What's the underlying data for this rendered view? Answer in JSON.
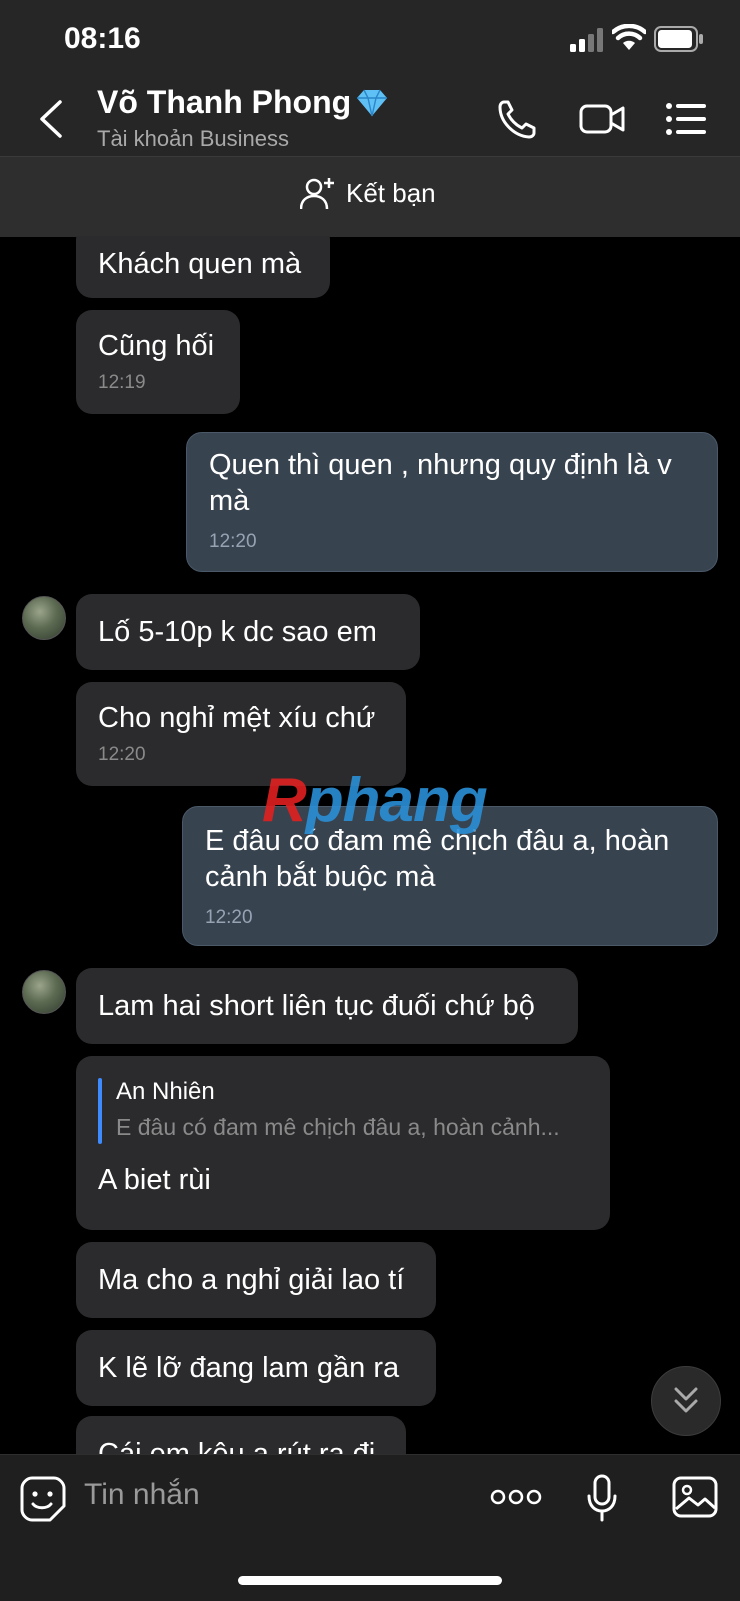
{
  "status": {
    "time": "08:16"
  },
  "header": {
    "name": "Võ Thanh Phong",
    "subtitle": "Tài khoản Business"
  },
  "friend_bar": {
    "label": "Kết bạn"
  },
  "messages": [
    {
      "dir": "in",
      "text": "Khách quen mà"
    },
    {
      "dir": "in",
      "text": "Cũng hối",
      "time": "12:19"
    },
    {
      "dir": "out",
      "text": "Quen thì quen , nhưng quy định là v mà",
      "time": "12:20"
    },
    {
      "dir": "in",
      "text": "Lố 5-10p k dc sao em"
    },
    {
      "dir": "in",
      "text": "Cho nghỉ mệt xíu chứ",
      "time": "12:20"
    },
    {
      "dir": "out",
      "text": "E đâu có đam mê chịch đâu a, hoàn cảnh bắt buộc mà",
      "time": "12:20"
    },
    {
      "dir": "in",
      "text": "Lam hai short liên tục đuối chứ bộ"
    },
    {
      "dir": "in",
      "quote_name": "An Nhiên",
      "quote_text": "E đâu có đam mê chịch đâu a, hoàn cảnh...",
      "text": "A biet rùi"
    },
    {
      "dir": "in",
      "text": "Ma cho a nghỉ giải lao tí"
    },
    {
      "dir": "in",
      "text": "K lẽ lỡ đang lam gần ra"
    },
    {
      "dir": "in",
      "text": "Cái em kêu a rút ra đi"
    }
  ],
  "watermark": {
    "r": "R",
    "rest": "phang"
  },
  "input": {
    "placeholder": "Tin nhắn"
  },
  "icons": {
    "back": "chevron-left-icon",
    "call": "phone-icon",
    "video": "video-camera-icon",
    "menu": "list-menu-icon",
    "add_friend": "add-user-icon",
    "sticker": "emoji-sticker-icon",
    "more": "more-dots-icon",
    "mic": "microphone-icon",
    "gallery": "image-gallery-icon",
    "scroll": "double-chevron-down-icon",
    "verified": "diamond-icon"
  },
  "colors": {
    "bg": "#000000",
    "bar": "#262626",
    "bubble_in": "#2b2b2d",
    "bubble_out": "#384350",
    "accent": "#3d8bff"
  }
}
